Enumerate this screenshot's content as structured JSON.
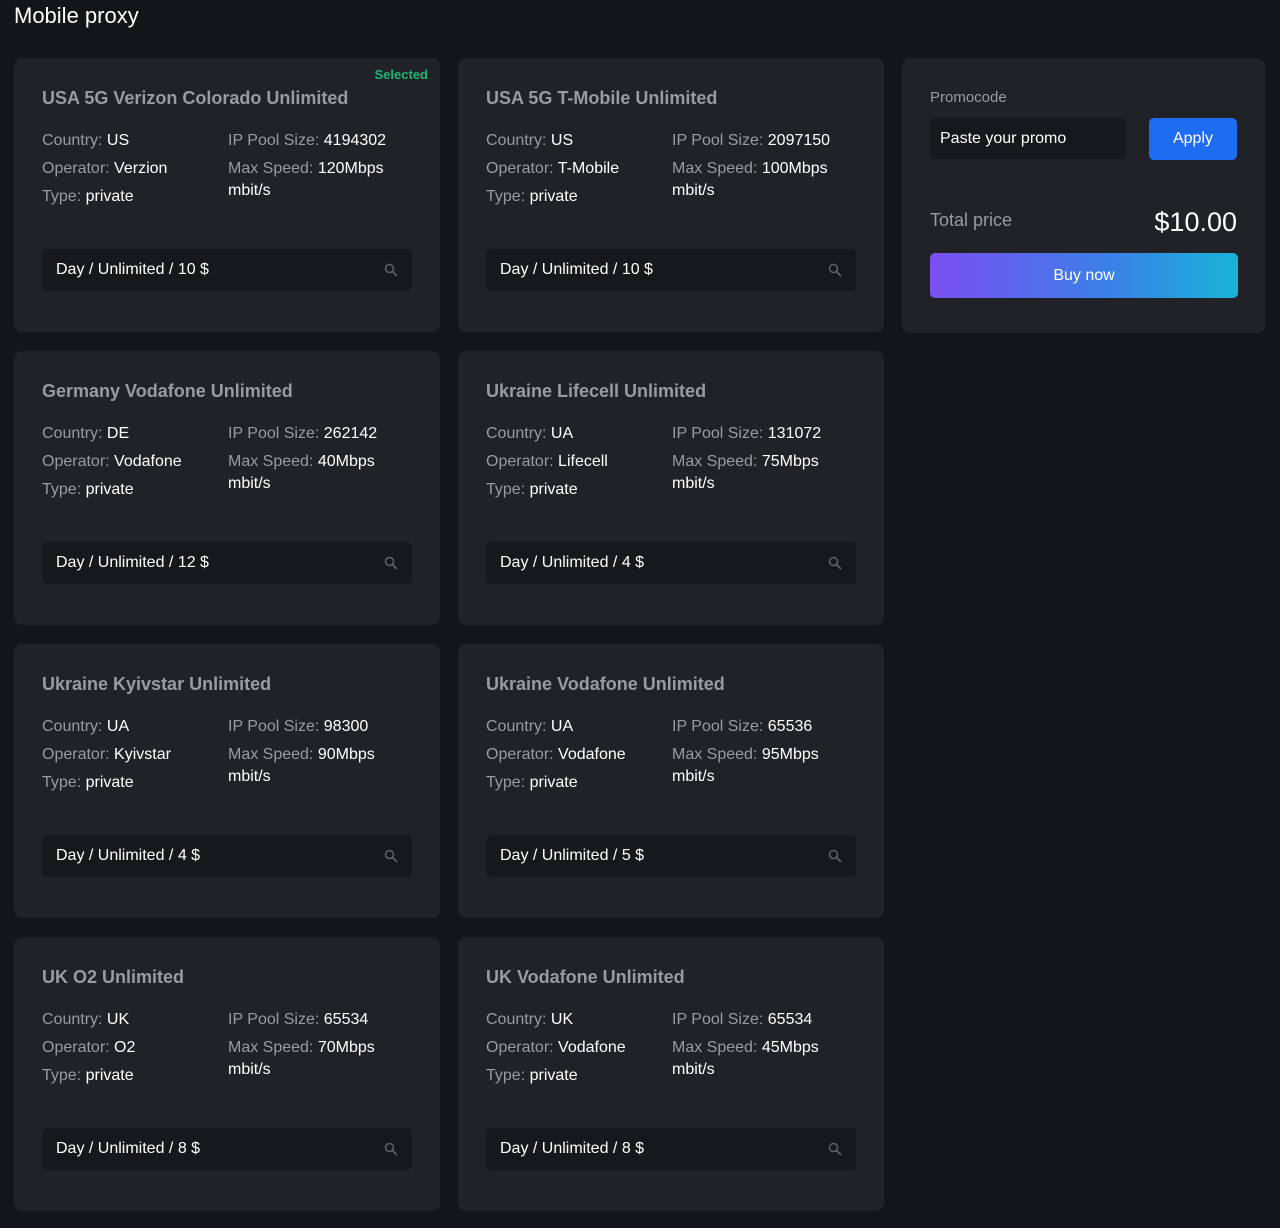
{
  "page": {
    "title": "Mobile proxy"
  },
  "labels": {
    "country": "Country:",
    "operator": "Operator:",
    "type": "Type:",
    "ip_pool": "IP Pool Size:",
    "max_speed": "Max Speed:",
    "speed_unit": "mbit/s",
    "selected": "Selected"
  },
  "icons": {
    "plan_select": "search-icon"
  },
  "colors": {
    "background": "#141519",
    "card": "#212227",
    "selected": "#21b573",
    "apply": "#1e6cf2",
    "buy_gradient": [
      "#7b4ff0",
      "#19b3d8"
    ]
  },
  "products": [
    {
      "title": "USA 5G Verizon Colorado Unlimited",
      "country": "US",
      "operator": "Verzion",
      "type": "private",
      "ip_pool": "4194302",
      "speed": "120Mbps",
      "plan": "Day / Unlimited / 10 $",
      "selected": true
    },
    {
      "title": "USA 5G T-Mobile Unlimited",
      "country": "US",
      "operator": "T-Mobile",
      "type": "private",
      "ip_pool": "2097150",
      "speed": "100Mbps",
      "plan": "Day / Unlimited / 10 $",
      "selected": false
    },
    {
      "title": "Germany Vodafone Unlimited",
      "country": "DE",
      "operator": "Vodafone",
      "type": "private",
      "ip_pool": "262142",
      "speed": "40Mbps",
      "plan": "Day / Unlimited / 12 $",
      "selected": false
    },
    {
      "title": "Ukraine Lifecell Unlimited",
      "country": "UA",
      "operator": "Lifecell",
      "type": "private",
      "ip_pool": "131072",
      "speed": "75Mbps",
      "plan": "Day / Unlimited / 4 $",
      "selected": false
    },
    {
      "title": "Ukraine Kyivstar Unlimited",
      "country": "UA",
      "operator": "Kyivstar",
      "type": "private",
      "ip_pool": "98300",
      "speed": "90Mbps",
      "plan": "Day / Unlimited / 4 $",
      "selected": false
    },
    {
      "title": "Ukraine Vodafone Unlimited",
      "country": "UA",
      "operator": "Vodafone",
      "type": "private",
      "ip_pool": "65536",
      "speed": "95Mbps",
      "plan": "Day / Unlimited / 5 $",
      "selected": false
    },
    {
      "title": "UK O2 Unlimited",
      "country": "UK",
      "operator": "O2",
      "type": "private",
      "ip_pool": "65534",
      "speed": "70Mbps",
      "plan": "Day / Unlimited / 8 $",
      "selected": false
    },
    {
      "title": "UK Vodafone Unlimited",
      "country": "UK",
      "operator": "Vodafone",
      "type": "private",
      "ip_pool": "65534",
      "speed": "45Mbps",
      "plan": "Day / Unlimited / 8 $",
      "selected": false
    }
  ],
  "checkout": {
    "promo_label": "Promocode",
    "promo_placeholder": "Paste your promo",
    "promo_value": "",
    "apply_label": "Apply",
    "total_label": "Total price",
    "total_value": "$10.00",
    "buy_label": "Buy now"
  }
}
